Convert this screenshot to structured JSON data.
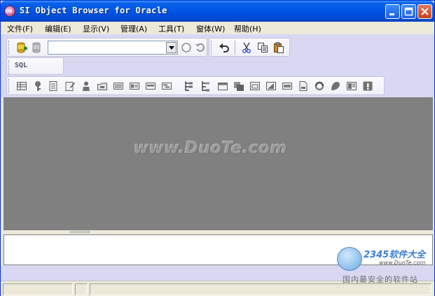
{
  "window": {
    "title": "SI Object Browser for Oracle",
    "icon": "db-globe-icon",
    "icon_text": "DB"
  },
  "menu": [
    {
      "label": "文件(F)"
    },
    {
      "label": "编辑(E)"
    },
    {
      "label": "显示(V)"
    },
    {
      "label": "管理(A)"
    },
    {
      "label": "工具(T)"
    },
    {
      "label": "窗体(W)"
    },
    {
      "label": "帮助(H)"
    }
  ],
  "toolbar1": {
    "connection_value": "",
    "icons": [
      "connect-icon",
      "disconnect-icon",
      "refresh-circle-icon",
      "reload-icon",
      "undo-icon",
      "cut-icon",
      "copy-icon",
      "paste-icon"
    ]
  },
  "toolbar2": {
    "sql_label": "SQL"
  },
  "toolbar3": {
    "icons": [
      "table-icon",
      "key-icon",
      "view-icon",
      "edit-doc-icon",
      "synonym-icon",
      "package-icon",
      "list-icon",
      "form-icon",
      "index-icon",
      "sequence-icon",
      "tree-icon",
      "tree2-icon",
      "window-icon",
      "stack-icon",
      "panel-icon",
      "image-icon",
      "field-icon",
      "report-icon",
      "cycle-icon",
      "user-icon",
      "grid-icon",
      "info-icon"
    ]
  },
  "watermark": "www.DuoTe.com",
  "logo": {
    "brand": "2345软件大全",
    "url": "www.DuoTe.com",
    "slogan": "国内最安全的软件站"
  },
  "colors": {
    "title_bar": "#0055E5",
    "toolbar_bg": "#D8D8F2",
    "workspace": "#808080"
  }
}
